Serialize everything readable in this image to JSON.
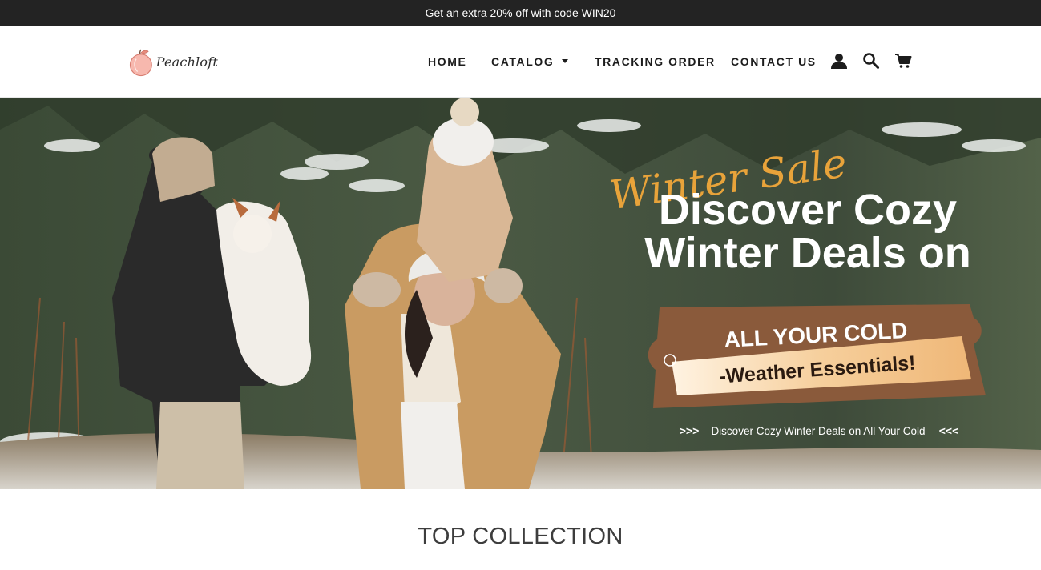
{
  "announcement": {
    "text": "Get an extra 20% off with code WIN20"
  },
  "brand": {
    "name": "Peachloft",
    "logo_color": "#f2a39a"
  },
  "nav": {
    "items": [
      {
        "label": "HOME"
      },
      {
        "label": "CATALOG"
      },
      {
        "label": "TRACKING ORDER"
      },
      {
        "label": "CONTACT US"
      }
    ],
    "icons": [
      "account-icon",
      "search-icon",
      "cart-icon"
    ]
  },
  "hero": {
    "script_title": "Winter Sale",
    "headline_line1": "Discover Cozy",
    "headline_line2": "Winter Deals on",
    "ticket_line1": "ALL YOUR COLD",
    "ticket_line2": "-Weather Essentials!",
    "caption": "Discover Cozy Winter Deals on All Your Cold",
    "caption_prefix": ">>>",
    "caption_suffix": "<<<",
    "colors": {
      "script": "#e8a33a",
      "ticket": "#8a5a3b",
      "badge": "#f4d1a8"
    }
  },
  "collection": {
    "title": "TOP COLLECTION"
  }
}
